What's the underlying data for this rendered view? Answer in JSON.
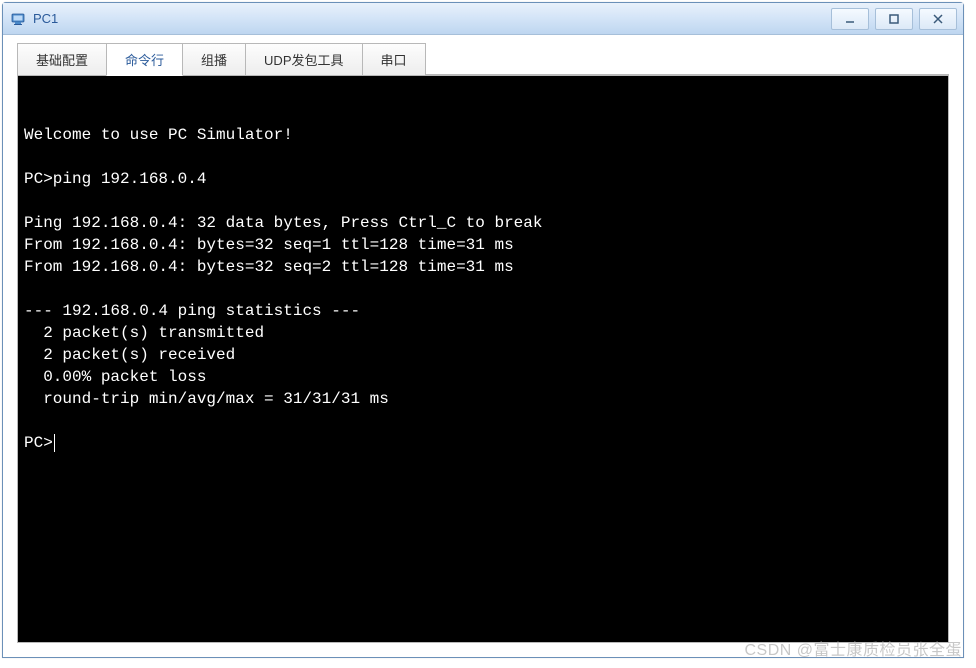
{
  "window": {
    "title": "PC1"
  },
  "tabs": {
    "items": [
      {
        "label": "基础配置",
        "active": false
      },
      {
        "label": "命令行",
        "active": true
      },
      {
        "label": "组播",
        "active": false
      },
      {
        "label": "UDP发包工具",
        "active": false
      },
      {
        "label": "串口",
        "active": false
      }
    ]
  },
  "terminal": {
    "lines": [
      "Welcome to use PC Simulator!",
      "",
      "PC>ping 192.168.0.4",
      "",
      "Ping 192.168.0.4: 32 data bytes, Press Ctrl_C to break",
      "From 192.168.0.4: bytes=32 seq=1 ttl=128 time=31 ms",
      "From 192.168.0.4: bytes=32 seq=2 ttl=128 time=31 ms",
      "",
      "--- 192.168.0.4 ping statistics ---",
      "  2 packet(s) transmitted",
      "  2 packet(s) received",
      "  0.00% packet loss",
      "  round-trip min/avg/max = 31/31/31 ms",
      ""
    ],
    "prompt": "PC>"
  },
  "watermark": "CSDN @富士康质检员张全蛋"
}
